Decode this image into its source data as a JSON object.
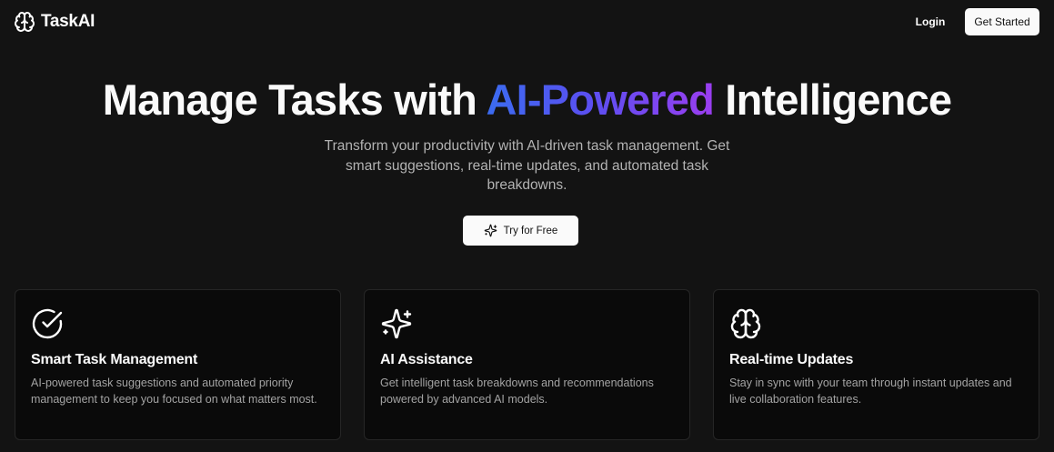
{
  "nav": {
    "logo_icon": "brain-icon",
    "brand": "TaskAI",
    "login_label": "Login",
    "cta_label": "Get Started"
  },
  "hero": {
    "title_pre": "Manage Tasks with ",
    "title_highlight": "AI-Powered",
    "title_post": " Intelligence",
    "subtitle": "Transform your productivity with AI-driven task management. Get smart suggestions, real-time updates, and automated task breakdowns.",
    "cta_icon": "sparkles-icon",
    "cta_label": "Try for Free"
  },
  "features": [
    {
      "icon": "check-circle-icon",
      "title": "Smart Task Management",
      "description": "AI-powered task suggestions and automated priority management to keep you focused on what matters most."
    },
    {
      "icon": "sparkles-icon",
      "title": "AI Assistance",
      "description": "Get intelligent task breakdowns and recommendations powered by advanced AI models."
    },
    {
      "icon": "brain-icon",
      "title": "Real-time Updates",
      "description": "Stay in sync with your team through instant updates and live collaboration features."
    }
  ],
  "colors": {
    "background": "#131313",
    "card_background": "#0a0a0a",
    "gradient_start": "#3b6cf0",
    "gradient_end": "#9b3ef0"
  }
}
